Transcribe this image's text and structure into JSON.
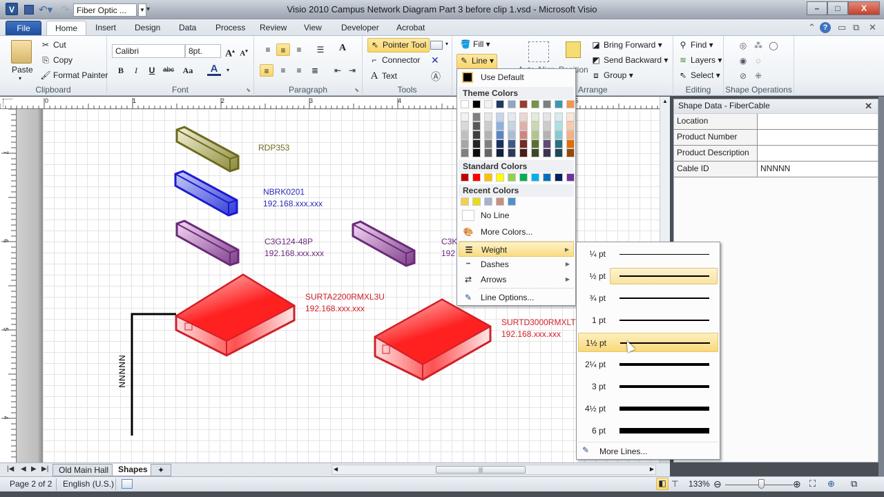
{
  "window": {
    "title": "Visio 2010 Campus Network Diagram Part 3 before clip 1.vsd  -  Microsoft Visio",
    "app_icon_label": "V",
    "shape_selector_value": "Fiber Optic ...",
    "controls": {
      "minimize": "–",
      "maximize": "□",
      "close": "X"
    }
  },
  "ribbon": {
    "tabs": [
      {
        "label": "File"
      },
      {
        "label": "Home",
        "active": true
      },
      {
        "label": "Insert"
      },
      {
        "label": "Design"
      },
      {
        "label": "Data"
      },
      {
        "label": "Process"
      },
      {
        "label": "Review"
      },
      {
        "label": "View"
      },
      {
        "label": "Developer"
      },
      {
        "label": "Acrobat"
      }
    ],
    "clipboard": {
      "paste": "Paste",
      "cut": "Cut",
      "copy": "Copy",
      "format_painter": "Format Painter",
      "label": "Clipboard"
    },
    "font": {
      "family": "Calibri",
      "size": "8pt.",
      "label": "Font",
      "bold": "B",
      "italic": "I",
      "underline": "U",
      "strike": "abc",
      "case": "Aa",
      "color": "A"
    },
    "paragraph": {
      "label": "Paragraph"
    },
    "tools": {
      "pointer": "Pointer Tool",
      "connector": "Connector",
      "text": "Text",
      "label": "Tools"
    },
    "shape": {
      "fill": "Fill",
      "line": "Line"
    },
    "arrange": {
      "auto_align": "Auto Align",
      "position": "Position",
      "bring_forward": "Bring Forward",
      "send_backward": "Send Backward",
      "group": "Group",
      "label": "Arrange"
    },
    "editing": {
      "find": "Find",
      "layers": "Layers",
      "select": "Select",
      "label": "Editing"
    },
    "shape_operations": {
      "label": "Shape Operations"
    }
  },
  "ruler": {
    "horizontal_ticks": [
      "0",
      "1",
      "2",
      "3",
      "4",
      "5"
    ],
    "vertical_ticks": [
      "7",
      "6",
      "5",
      "4"
    ]
  },
  "diagram": {
    "shapes": [
      {
        "name": "RDP353",
        "ip": "",
        "color": "#6b6b1e"
      },
      {
        "name": "NBRK0201",
        "ip": "192.168.xxx.xxx",
        "color": "#2a2ab8"
      },
      {
        "name": "C3G124-48P",
        "ip": "192.168.xxx.xxx",
        "color": "#6a2a7a"
      },
      {
        "name": "C3K",
        "ip": "192",
        "color": "#6a2a7a"
      },
      {
        "name": "SURTA2200RMXL3U",
        "ip": "192.168.xxx.xxx",
        "color": "#d0202a"
      },
      {
        "name": "SURTD3000RMXLT",
        "ip": "192.168.xxx.xxx",
        "color": "#d0202a"
      }
    ],
    "cable_label": "NNNNN"
  },
  "line_menu": {
    "use_default": "Use Default",
    "theme_colors_label": "Theme Colors",
    "theme_colors": [
      "#ffffff",
      "#000000",
      "#f2f2f2",
      "#1f3864",
      "#8fa6c4",
      "#9c3b31",
      "#76934a",
      "#7f7f7f",
      "#3e97b0",
      "#f59648"
    ],
    "theme_shades": [
      [
        "#f2f2f2",
        "#d9d9d9",
        "#bfbfbf",
        "#a6a6a6",
        "#808080"
      ],
      [
        "#7f7f7f",
        "#595959",
        "#404040",
        "#262626",
        "#0d0d0d"
      ],
      [
        "#e6e6e6",
        "#cccccc",
        "#b3b3b3",
        "#808080",
        "#666666"
      ],
      [
        "#c6d4ec",
        "#8db0e0",
        "#5984c8",
        "#17305f",
        "#10203f"
      ],
      [
        "#e3e9f1",
        "#c8d3e4",
        "#abbcd6",
        "#3f5a86",
        "#2a3c59"
      ],
      [
        "#f0d6d3",
        "#e1aea8",
        "#d2857c",
        "#742b23",
        "#4d1d17"
      ],
      [
        "#e4ecd8",
        "#cad9b2",
        "#b0c68b",
        "#586e37",
        "#3b4925"
      ],
      [
        "#e5e5e5",
        "#cccccc",
        "#b2b2b2",
        "#5f4b73",
        "#3f3250"
      ],
      [
        "#d6ecf1",
        "#ade0e3",
        "#84c9d6",
        "#2c6e80",
        "#1d4955"
      ],
      [
        "#fde5d4",
        "#fbcaa9",
        "#f9af7e",
        "#e36c09",
        "#974806"
      ]
    ],
    "standard_colors_label": "Standard Colors",
    "standard_colors": [
      "#c00000",
      "#ff0000",
      "#ffc000",
      "#ffff00",
      "#92d050",
      "#00b050",
      "#00b0f0",
      "#0070c0",
      "#002060",
      "#7030a0"
    ],
    "recent_colors_label": "Recent Colors",
    "recent_colors": [
      "#f5d04a",
      "#e6dc20",
      "#a8b0d0",
      "#c89080",
      "#5090cc"
    ],
    "no_line": "No Line",
    "more_colors": "More Colors...",
    "weight": "Weight",
    "dashes": "Dashes",
    "arrows": "Arrows",
    "line_options": "Line Options..."
  },
  "weight_menu": {
    "items": [
      {
        "label": "¼ pt",
        "pt": 0.25
      },
      {
        "label": "½ pt",
        "pt": 0.5,
        "selected": true
      },
      {
        "label": "¾ pt",
        "pt": 0.75
      },
      {
        "label": "1 pt",
        "pt": 1
      },
      {
        "label": "1½ pt",
        "pt": 1.5,
        "hover": true
      },
      {
        "label": "2¼ pt",
        "pt": 2.25
      },
      {
        "label": "3 pt",
        "pt": 3
      },
      {
        "label": "4½ pt",
        "pt": 4.5
      },
      {
        "label": "6 pt",
        "pt": 6
      }
    ],
    "more_lines": "More Lines..."
  },
  "shape_data_panel": {
    "title": "Shape Data - FiberCable",
    "rows": [
      {
        "key": "Location",
        "value": ""
      },
      {
        "key": "Product Number",
        "value": ""
      },
      {
        "key": "Product Description",
        "value": ""
      },
      {
        "key": "Cable ID",
        "value": "NNNNN"
      }
    ]
  },
  "page_tabs": [
    {
      "label": "Old Main Hall"
    },
    {
      "label": "Shapes",
      "active": true
    }
  ],
  "status": {
    "page": "Page 2 of 2",
    "language": "English (U.S.)",
    "zoom": "133%",
    "zoom_fraction": 0.5
  }
}
